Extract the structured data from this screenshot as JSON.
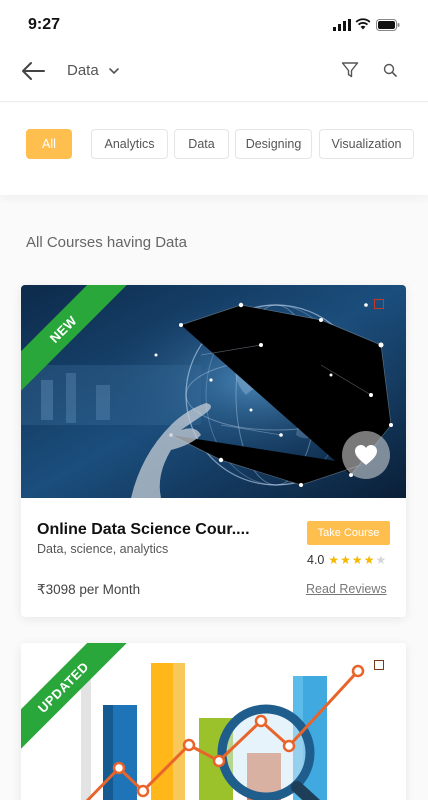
{
  "status_bar": {
    "time": "9:27"
  },
  "header": {
    "title": "Data"
  },
  "chips": [
    {
      "label": "All",
      "active": true
    },
    {
      "label": "Analytics",
      "active": false
    },
    {
      "label": "Data",
      "active": false
    },
    {
      "label": "Designing",
      "active": false
    },
    {
      "label": "Visualization",
      "active": false
    }
  ],
  "section_title": "All Courses having Data",
  "courses": [
    {
      "ribbon": "NEW",
      "title": "Online Data Science Cour....",
      "tags": "Data, science, analytics",
      "button": "Take Course",
      "rating": "4.0",
      "stars_filled": 4,
      "stars_total": 5,
      "price": "₹3098 per Month",
      "reviews_link": "Read Reviews"
    },
    {
      "ribbon": "UPDATED"
    }
  ],
  "colors": {
    "accent": "#ffbf4f",
    "ribbon": "#2aa73a",
    "star": "#f5b800"
  }
}
